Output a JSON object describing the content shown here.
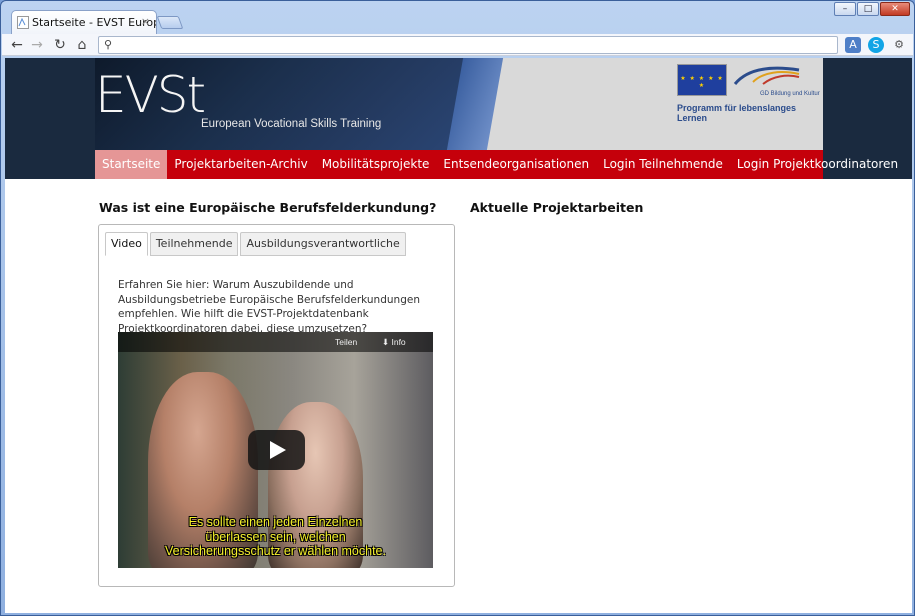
{
  "browser": {
    "tab_title": "Startseite - EVST European",
    "tab_close": "×",
    "window_buttons": [
      "–",
      "□",
      "✕"
    ],
    "nav_icons": [
      "back-icon",
      "forward-icon",
      "reload-icon",
      "home-icon"
    ],
    "address_value": ""
  },
  "header": {
    "logo_text": "EVSt",
    "logo_subtitle": "European Vocational Skills Training",
    "gd_text": "GD Bildung und Kultur",
    "program_text": "Programm für lebenslanges Lernen",
    "eu_stars": "★ ★ ★ ★ ★ ★"
  },
  "nav": {
    "items": [
      {
        "label": "Startseite",
        "active": true
      },
      {
        "label": "Projektarbeiten-Archiv"
      },
      {
        "label": "Mobilitätsprojekte"
      },
      {
        "label": "Entsendeorganisationen"
      },
      {
        "label": "Login Teilnehmende"
      },
      {
        "label": "Login Projektkoordinatoren"
      }
    ]
  },
  "main": {
    "left_title": "Was ist eine Europäische Berufsfelderkundung?",
    "right_title": "Aktuelle Projektarbeiten",
    "tabs": [
      {
        "label": "Video",
        "active": true
      },
      {
        "label": "Teilnehmende"
      },
      {
        "label": "Ausbildungsverantwortliche"
      }
    ],
    "description": "Erfahren Sie hier: Warum Auszubildende und Ausbildungsbetriebe Europäische Berufsfelderkundungen empfehlen. Wie hilft die EVST-Projektdatenbank Projektkoordinatoren dabei, diese umzusetzen?",
    "video": {
      "share_label": "Teilen",
      "info_label": "Info",
      "subtitle_line1": "Es sollte einen jeden Einzelnen",
      "subtitle_line2": "überlassen sein, welchen",
      "subtitle_line3": "Versicherungsschutz er wählen möchte."
    }
  }
}
